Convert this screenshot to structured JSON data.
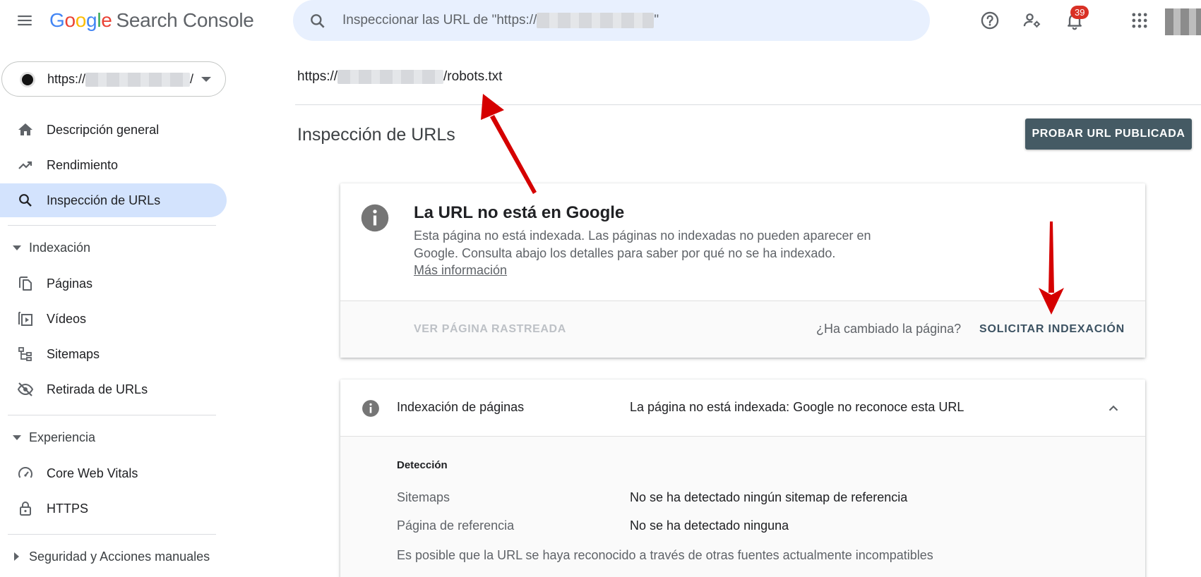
{
  "app": {
    "logo_google": [
      "G",
      "o",
      "o",
      "g",
      "l",
      "e"
    ],
    "logo_product": "Search Console"
  },
  "search": {
    "placeholder_prefix": "Inspeccionar las URL de \"https://",
    "placeholder_suffix": "\""
  },
  "header": {
    "notifications_count": "39",
    "icons": [
      "help-icon",
      "manage-users-icon",
      "notifications-icon",
      "apps-grid-icon"
    ]
  },
  "property": {
    "url_prefix": "https://",
    "url_suffix": "/"
  },
  "sidebar": {
    "items_top": [
      {
        "label": "Descripción general",
        "icon": "home-icon"
      },
      {
        "label": "Rendimiento",
        "icon": "trending-up-icon"
      },
      {
        "label": "Inspección de URLs",
        "icon": "search-icon",
        "active": true
      }
    ],
    "sections": [
      {
        "label": "Indexación",
        "expanded": true,
        "items": [
          {
            "label": "Páginas",
            "icon": "pages-icon"
          },
          {
            "label": "Vídeos",
            "icon": "video-icon"
          },
          {
            "label": "Sitemaps",
            "icon": "sitemap-icon"
          },
          {
            "label": "Retirada de URLs",
            "icon": "visibility-off-icon"
          }
        ]
      },
      {
        "label": "Experiencia",
        "expanded": true,
        "items": [
          {
            "label": "Core Web Vitals",
            "icon": "speed-icon"
          },
          {
            "label": "HTTPS",
            "icon": "lock-icon"
          }
        ]
      },
      {
        "label": "Seguridad y Acciones manuales",
        "expanded": false,
        "items": []
      }
    ]
  },
  "main": {
    "inspected_url_prefix": "https://",
    "inspected_url_suffix": "/robots.txt",
    "title": "Inspección de URLs",
    "test_live_button": "PROBAR URL PUBLICADA",
    "status_card": {
      "title": "La URL no está en Google",
      "description": "Esta página no está indexada. Las páginas no indexadas no pueden aparecer en Google. Consulta abajo los detalles para saber por qué no se ha indexado.",
      "more_link": "Más información",
      "view_crawled": "VER PÁGINA RASTREADA",
      "changed_question": "¿Ha cambiado la página?",
      "request_indexing": "SOLICITAR INDEXACIÓN"
    },
    "indexing_card": {
      "label": "Indexación de páginas",
      "status": "La página no está indexada: Google no reconoce esta URL",
      "detection_title": "Detección",
      "rows": [
        {
          "label": "Sitemaps",
          "value": "No se ha detectado ningún sitemap de referencia"
        },
        {
          "label": "Página de referencia",
          "value": "No se ha detectado ninguna"
        }
      ],
      "note": "Es posible que la URL se haya reconocido a través de otras fuentes actualmente incompatibles"
    }
  },
  "colors": {
    "active_nav_bg": "#d3e3fd",
    "search_bg": "#e8f0fe",
    "primary_button": "#455a64",
    "annotation_arrow": "#d50000",
    "badge": "#d93025"
  }
}
